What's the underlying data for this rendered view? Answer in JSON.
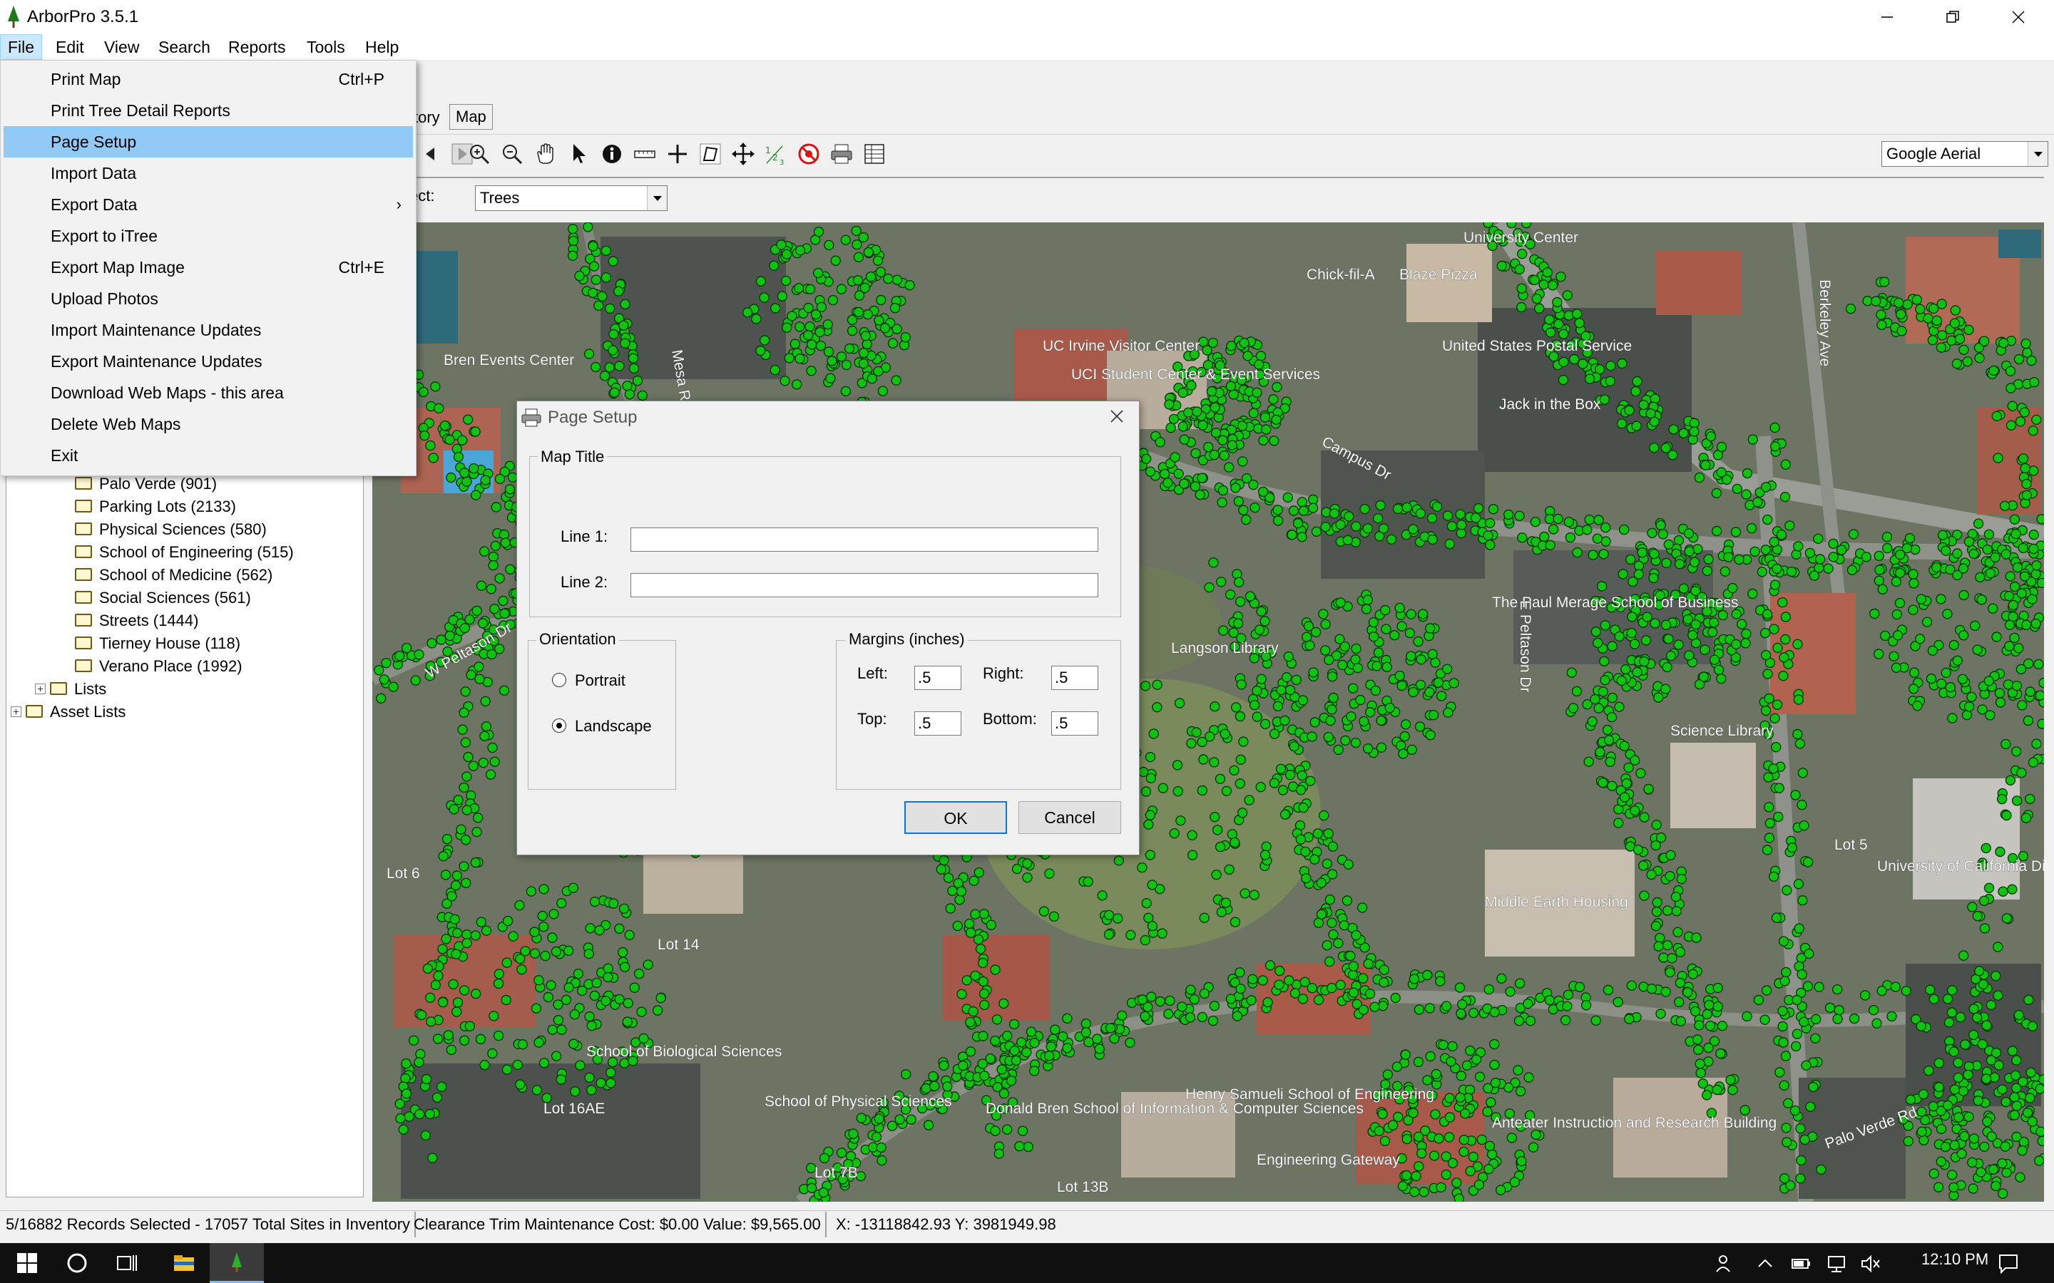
{
  "window": {
    "title": "ArborPro 3.5.1"
  },
  "menubar": [
    {
      "label": "File"
    },
    {
      "label": "Edit"
    },
    {
      "label": "View"
    },
    {
      "label": "Search"
    },
    {
      "label": "Reports"
    },
    {
      "label": "Tools"
    },
    {
      "label": "Help"
    }
  ],
  "file_menu": [
    {
      "label": "Print Map",
      "shortcut": "Ctrl+P"
    },
    {
      "label": "Print Tree Detail Reports",
      "shortcut": ""
    },
    {
      "label": "Page Setup",
      "shortcut": "",
      "highlighted": true
    },
    {
      "label": "Import Data",
      "shortcut": ""
    },
    {
      "label": "Export Data",
      "shortcut": "",
      "submenu": "›"
    },
    {
      "label": "Export to iTree",
      "shortcut": ""
    },
    {
      "label": "Export Map Image",
      "shortcut": "Ctrl+E"
    },
    {
      "label": "Upload Photos",
      "shortcut": ""
    },
    {
      "label": "Import Maintenance Updates",
      "shortcut": ""
    },
    {
      "label": "Export Maintenance Updates",
      "shortcut": ""
    },
    {
      "label": "Download Web Maps - this area",
      "shortcut": ""
    },
    {
      "label": "Delete Web Maps",
      "shortcut": ""
    },
    {
      "label": "Exit",
      "shortcut": ""
    }
  ],
  "tabs": {
    "inventory_partial": "tory",
    "map": "Map"
  },
  "toolbar": {
    "basemap": "Google Aerial",
    "select_label": "ect:",
    "select_value": "Trees"
  },
  "tree": {
    "items": [
      {
        "label": "Palo Verde (901)"
      },
      {
        "label": "Parking Lots (2133)"
      },
      {
        "label": "Physical Sciences (580)"
      },
      {
        "label": "School of Engineering (515)"
      },
      {
        "label": "School of Medicine (562)"
      },
      {
        "label": "Social Sciences (561)"
      },
      {
        "label": "Streets (1444)"
      },
      {
        "label": "Tierney House (118)"
      },
      {
        "label": "Verano Place (1992)"
      }
    ],
    "lists": "Lists",
    "asset_lists": "Asset Lists"
  },
  "map_labels": [
    {
      "text": "University Center"
    },
    {
      "text": "Chick-fil-A"
    },
    {
      "text": "Blaze Pizza"
    },
    {
      "text": "United States Postal Service"
    },
    {
      "text": "Jack in the Box"
    },
    {
      "text": "UC Irvine Visitor Center"
    },
    {
      "text": "UCI Student Center & Event Services"
    },
    {
      "text": "Campus Dr"
    },
    {
      "text": "Berkeley Ave"
    },
    {
      "text": "The Paul Merage School of Business"
    },
    {
      "text": "Langson Library"
    },
    {
      "text": "Science Library"
    },
    {
      "text": "School of Physical Sciences"
    },
    {
      "text": "School of Biological Sciences"
    },
    {
      "text": "Lot 16AE"
    },
    {
      "text": "Donald Bren School of Information & Computer Sciences"
    },
    {
      "text": "Henry Samueli School of Engineering"
    },
    {
      "text": "Engineering Gateway"
    },
    {
      "text": "Anteater Instruction and Research Building"
    },
    {
      "text": "Lot 13B"
    },
    {
      "text": "Lot 7B"
    },
    {
      "text": "Lot 6"
    },
    {
      "text": "Middle Earth Housing"
    },
    {
      "text": "W Peltason Dr"
    },
    {
      "text": "E Peltason Dr"
    },
    {
      "text": "Bren Events Center"
    },
    {
      "text": "Mesa Rd"
    },
    {
      "text": "Palo Verde Rd"
    },
    {
      "text": "Lot 14"
    },
    {
      "text": "Lot 5"
    },
    {
      "text": "University of California Division of..."
    }
  ],
  "dialog": {
    "title": "Page Setup",
    "map_title_group": "Map Title",
    "line1_label": "Line 1:",
    "line1_value": "",
    "line2_label": "Line 2:",
    "line2_value": "",
    "orientation_group": "Orientation",
    "portrait": "Portrait",
    "landscape": "Landscape",
    "orientation_selected": "Landscape",
    "margins_group": "Margins (inches)",
    "left_label": "Left:",
    "left_value": ".5",
    "right_label": "Right:",
    "right_value": ".5",
    "top_label": "Top:",
    "top_value": ".5",
    "bottom_label": "Bottom:",
    "bottom_value": ".5",
    "ok": "OK",
    "cancel": "Cancel"
  },
  "statusbar": {
    "records": "5/16882 Records Selected - 17057 Total Sites in Inventory",
    "cost": "Clearance Trim Maintenance Cost:  $0.00  Value:  $9,565.00",
    "coords": "X: -13118842.93  Y: 3981949.98"
  },
  "taskbar": {
    "time": "12:10 PM"
  },
  "colors": {
    "menu_highlight": "#91c9f7",
    "tree_dot": "#12c212",
    "taskbar": "#101010"
  }
}
